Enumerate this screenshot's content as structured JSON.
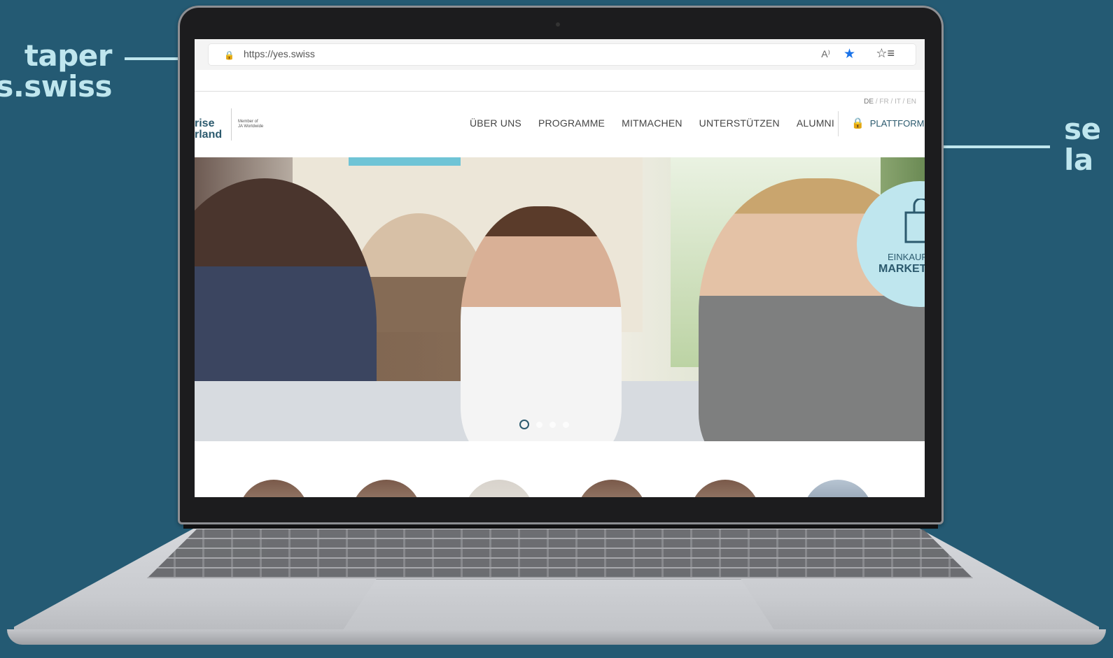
{
  "callouts": {
    "left_line1": "taper",
    "left_line2": "es.swiss",
    "right_line1": "se",
    "right_line2": "la"
  },
  "browser": {
    "url": "https://yes.swiss",
    "read_aloud_label": "A⁾",
    "favorite_star": "★",
    "favorites_list": "☆≡"
  },
  "site": {
    "logo_line1": "rise",
    "logo_line2": "rland",
    "member_line1": "Member of",
    "member_line2": "JA Worldwide",
    "lang_current": "DE",
    "lang_others": " / FR / IT / EN",
    "nav": [
      "ÜBER UNS",
      "PROGRAMME",
      "MITMACHEN",
      "UNTERSTÜTZEN",
      "ALUMNI"
    ],
    "platform_label": "PLATTFORM",
    "badge_line1": "EINKAUF",
    "badge_line2": "MARKET"
  },
  "icons": {
    "lock": "lock-icon",
    "bag": "shopping-bag-icon",
    "star": "star-icon",
    "read_aloud": "read-aloud-icon",
    "favorites": "favorites-icon"
  },
  "colors": {
    "background": "#245a73",
    "accent": "#bfe6ee",
    "brand": "#2c5a6e",
    "favorite": "#1a73e8"
  }
}
